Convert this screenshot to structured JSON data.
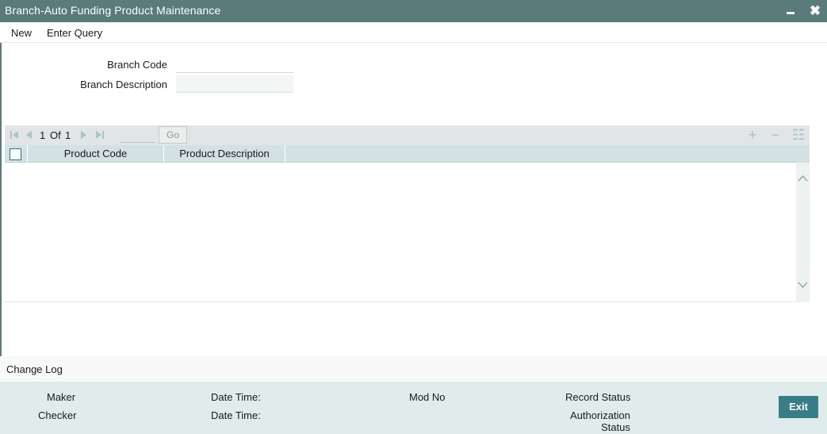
{
  "window": {
    "title": "Branch-Auto Funding Product Maintenance",
    "minimize_icon": "minimize-icon",
    "close_icon": "close-icon",
    "close_glyph": "✖"
  },
  "menu": {
    "new_label": "New",
    "enter_query_label": "Enter Query"
  },
  "form": {
    "branch_code_label": "Branch Code",
    "branch_code_value": "",
    "branch_description_label": "Branch Description",
    "branch_description_value": ""
  },
  "grid": {
    "pagination": {
      "current": "1",
      "of_label": "Of",
      "total": "1",
      "page_input": "",
      "go_label": "Go"
    },
    "toolbar_icons": {
      "add": "+",
      "delete": "−",
      "view": "☷"
    },
    "columns": [
      "Product Code",
      "Product Description"
    ],
    "rows": []
  },
  "changelog": {
    "label": "Change Log"
  },
  "footer": {
    "maker_label": "Maker",
    "checker_label": "Checker",
    "date_time_label_1": "Date Time:",
    "date_time_label_2": "Date Time:",
    "mod_no_label": "Mod No",
    "record_status_label": "Record Status",
    "authorization_status_label_1": "Authorization",
    "authorization_status_label_2": "Status",
    "exit_label": "Exit"
  },
  "colors": {
    "title_bar": "#5a7a7b",
    "grid_header": "#d3e1e4",
    "footer_bg": "#e0ecec",
    "exit_button": "#3a7c87"
  }
}
